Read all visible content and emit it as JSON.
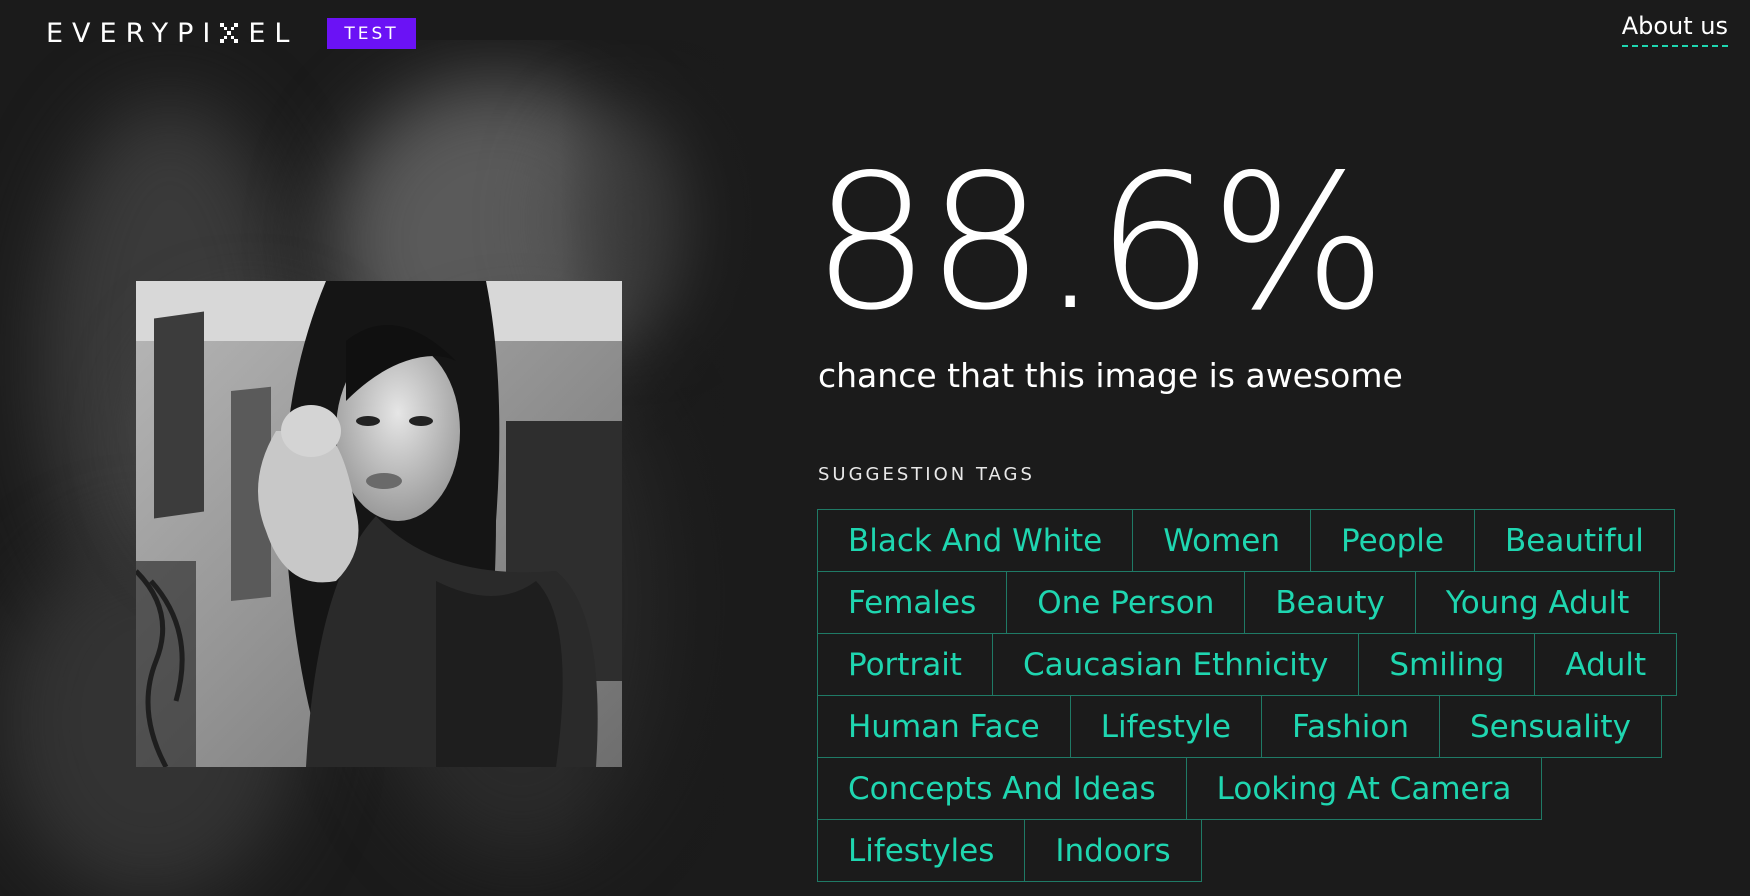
{
  "header": {
    "logo_text": "EVERYPI",
    "logo_text_tail": "EL",
    "badge": "TEST",
    "about_link": "About us"
  },
  "result": {
    "score": "88.6%",
    "caption": "chance that this image is awesome"
  },
  "tags": {
    "title": "SUGGESTION TAGS",
    "rows": [
      [
        "Black And White",
        "Women",
        "People",
        "Beautiful"
      ],
      [
        "Females",
        "One Person",
        "Beauty",
        "Young Adult"
      ],
      [
        "Portrait",
        "Caucasian Ethnicity",
        "Smiling",
        "Adult"
      ],
      [
        "Human Face",
        "Lifestyle",
        "Fashion",
        "Sensuality"
      ],
      [
        "Concepts And Ideas",
        "Looking At Camera"
      ],
      [
        "Lifestyles",
        "Indoors"
      ]
    ]
  },
  "colors": {
    "background": "#1b1b1b",
    "accent_tag": "#1fd6b0",
    "tag_border": "#1f7a66",
    "badge": "#6b12f5"
  }
}
